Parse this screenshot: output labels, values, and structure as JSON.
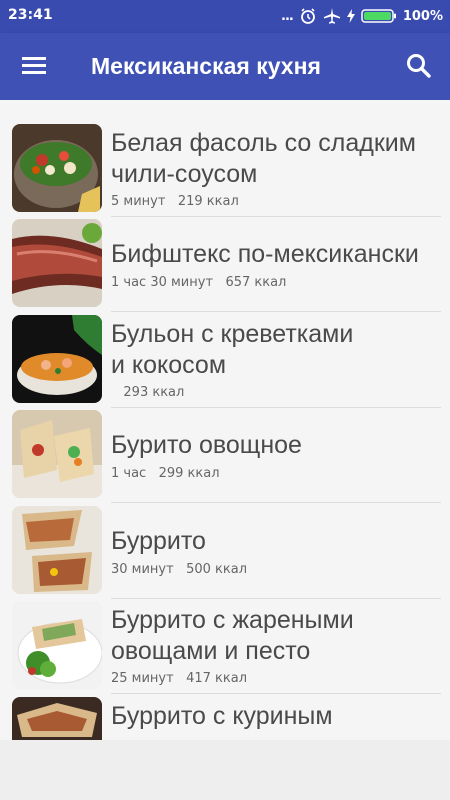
{
  "status": {
    "time": "23:41",
    "battery": "100%",
    "dots": "..."
  },
  "header": {
    "title": "Мексиканская кухня"
  },
  "recipes": [
    {
      "title_line1": "Белая фасоль со сладким",
      "title_line2": "чили-соусом",
      "time": "5 минут",
      "calories": "219 ккал"
    },
    {
      "title_line1": "Бифштекс по-мексикански",
      "time": "1 час 30 минут",
      "calories": "657 ккал"
    },
    {
      "title_line1": "Бульон с креветками",
      "title_line2": "и кокосом",
      "time": "",
      "calories": "293 ккал"
    },
    {
      "title_line1": "Бурито овощное",
      "time": "1 час",
      "calories": "299 ккал"
    },
    {
      "title_line1": "Буррито",
      "time": "30 минут",
      "calories": "500 ккал"
    },
    {
      "title_line1": "Буррито с жареными",
      "title_line2": "овощами и песто",
      "time": "25 минут",
      "calories": "417 ккал"
    },
    {
      "title_line1": "Буррито с куриным"
    }
  ],
  "colors": {
    "app_bar": "#3f51b5",
    "status_bar": "#3a4bb0",
    "background": "#eeeeee",
    "battery": "#4cd964"
  }
}
